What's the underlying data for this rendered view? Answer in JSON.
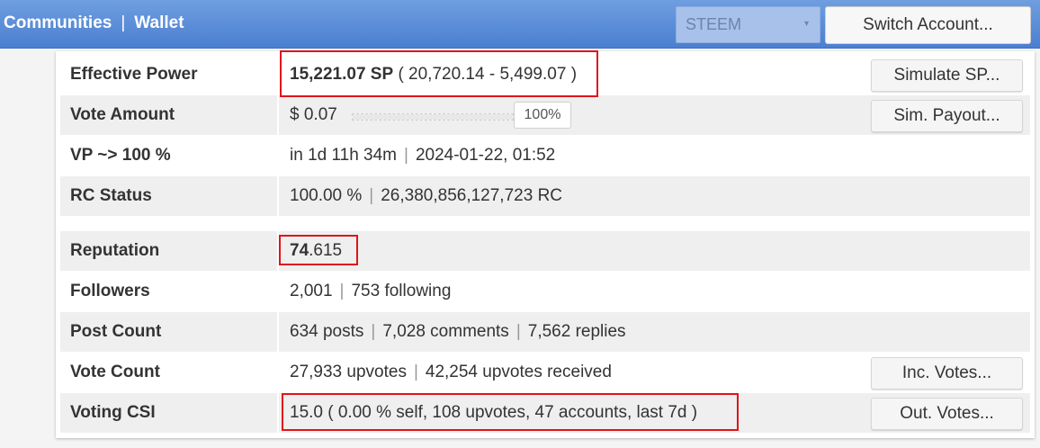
{
  "nav": {
    "communities": "Communities",
    "separator": "|",
    "wallet": "Wallet"
  },
  "currency_select": {
    "value": "STEEM",
    "caret": "▾"
  },
  "switch_account": "Switch Account...",
  "rows": {
    "effective_power": {
      "label": "Effective Power",
      "sp": "15,221.07 SP",
      "detail": "( 20,720.14 - 5,499.07 )",
      "button": "Simulate SP..."
    },
    "vote_amount": {
      "label": "Vote Amount",
      "value": "$ 0.07",
      "slider_percent": 100,
      "percent_label": "100%",
      "button": "Sim. Payout..."
    },
    "vp": {
      "label": "VP ~> 100 %",
      "time": "in 1d 11h 34m",
      "date": "2024-01-22, 01:52"
    },
    "rc_status": {
      "label": "RC Status",
      "percent": "100.00 %",
      "rc": "26,380,856,127,723 RC"
    },
    "reputation": {
      "label": "Reputation",
      "int": "74",
      "dec": ".615"
    },
    "followers": {
      "label": "Followers",
      "count": "2,001",
      "following": "753 following"
    },
    "post_count": {
      "label": "Post Count",
      "posts": "634 posts",
      "comments": "7,028 comments",
      "replies": "7,562 replies"
    },
    "vote_count": {
      "label": "Vote Count",
      "upvotes": "27,933 upvotes",
      "received": "42,254 upvotes received",
      "button": "Inc. Votes..."
    },
    "voting_csi": {
      "label": "Voting CSI",
      "value": "15.0 ( 0.00 % self, 108 upvotes, 47 accounts, last 7d )",
      "button": "Out. Votes..."
    }
  },
  "pipe": "|"
}
